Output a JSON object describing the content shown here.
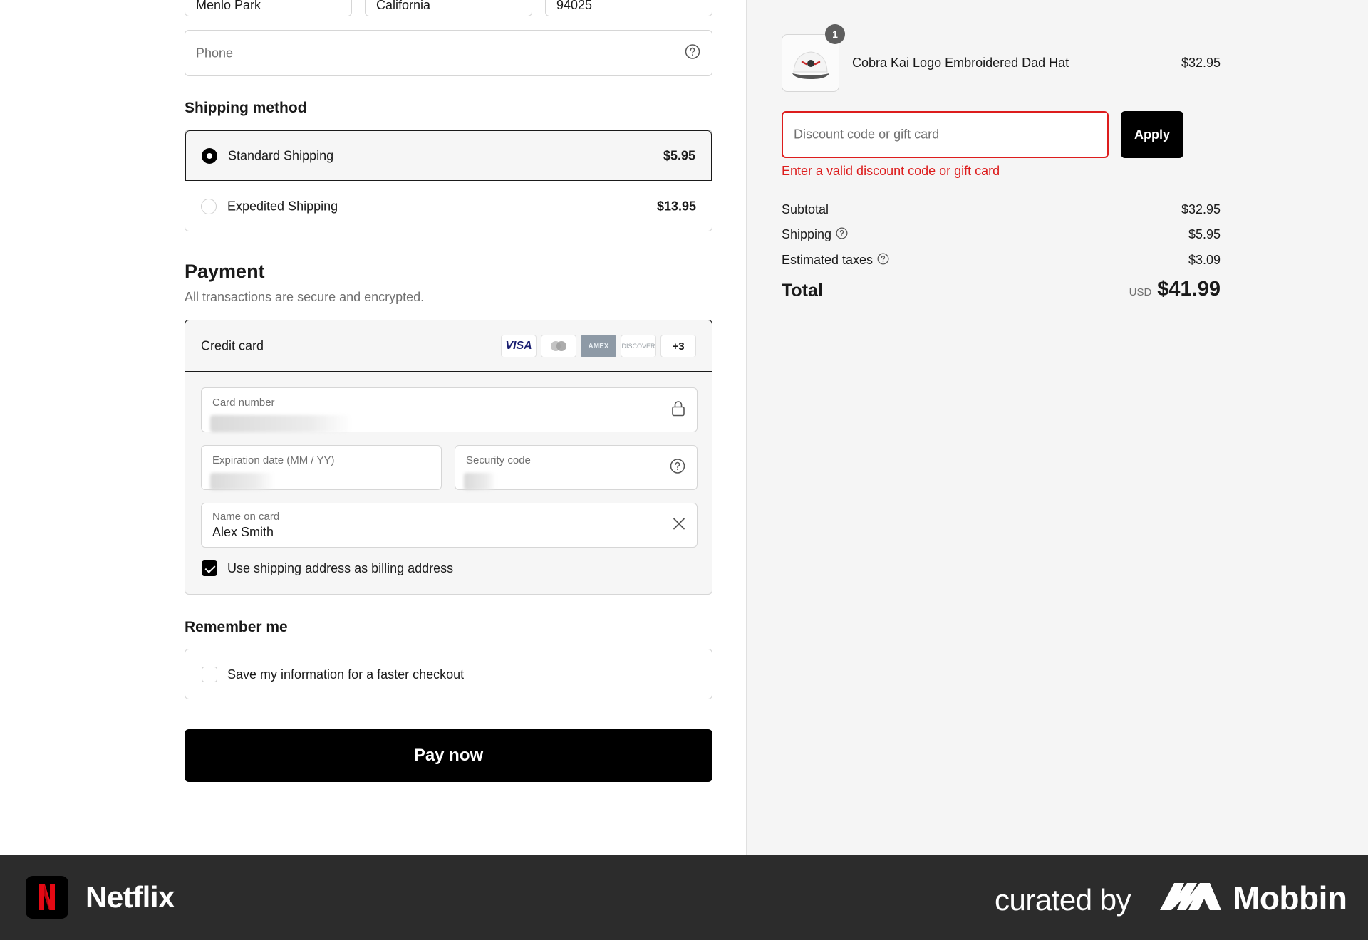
{
  "address": {
    "city": "Menlo Park",
    "state": "California",
    "zip": "94025",
    "phone_placeholder": "Phone"
  },
  "shipping": {
    "heading": "Shipping method",
    "options": [
      {
        "name": "Standard Shipping",
        "price": "$5.95",
        "selected": true
      },
      {
        "name": "Expedited Shipping",
        "price": "$13.95",
        "selected": false
      }
    ]
  },
  "payment": {
    "heading": "Payment",
    "subtitle": "All transactions are secure and encrypted.",
    "method": "Credit card",
    "brands": [
      "VISA",
      "mastercard",
      "AMEX",
      "DISCOVER"
    ],
    "more_brands": "+3",
    "card_number_label": "Card number",
    "expiration_label": "Expiration date (MM / YY)",
    "security_label": "Security code",
    "name_label": "Name on card",
    "name_value": "Alex Smith",
    "billing_checkbox_label": "Use shipping address as billing address",
    "billing_checked": true
  },
  "remember": {
    "heading": "Remember me",
    "checkbox_label": "Save my information for a faster checkout",
    "checked": false
  },
  "pay_button": "Pay now",
  "summary": {
    "item_name": "Cobra Kai Logo Embroidered Dad Hat",
    "item_price": "$32.95",
    "item_quantity": "1",
    "discount_placeholder": "Discount code or gift card",
    "apply_label": "Apply",
    "error_text": "Enter a valid discount code or gift card",
    "subtotal_label": "Subtotal",
    "subtotal_value": "$32.95",
    "shipping_label": "Shipping",
    "shipping_value": "$5.95",
    "taxes_label": "Estimated taxes",
    "taxes_value": "$3.09",
    "total_label": "Total",
    "currency": "USD",
    "total_value": "$41.99"
  },
  "footer": {
    "app_name": "Netflix",
    "curated_text": "curated by",
    "brand": "Mobbin"
  },
  "colors": {
    "accent": "#000000",
    "error": "#dd1d1d",
    "sidebar_bg": "#f5f5f5",
    "footer_bg": "#2c2c2c",
    "netflix_red": "#e50914"
  }
}
